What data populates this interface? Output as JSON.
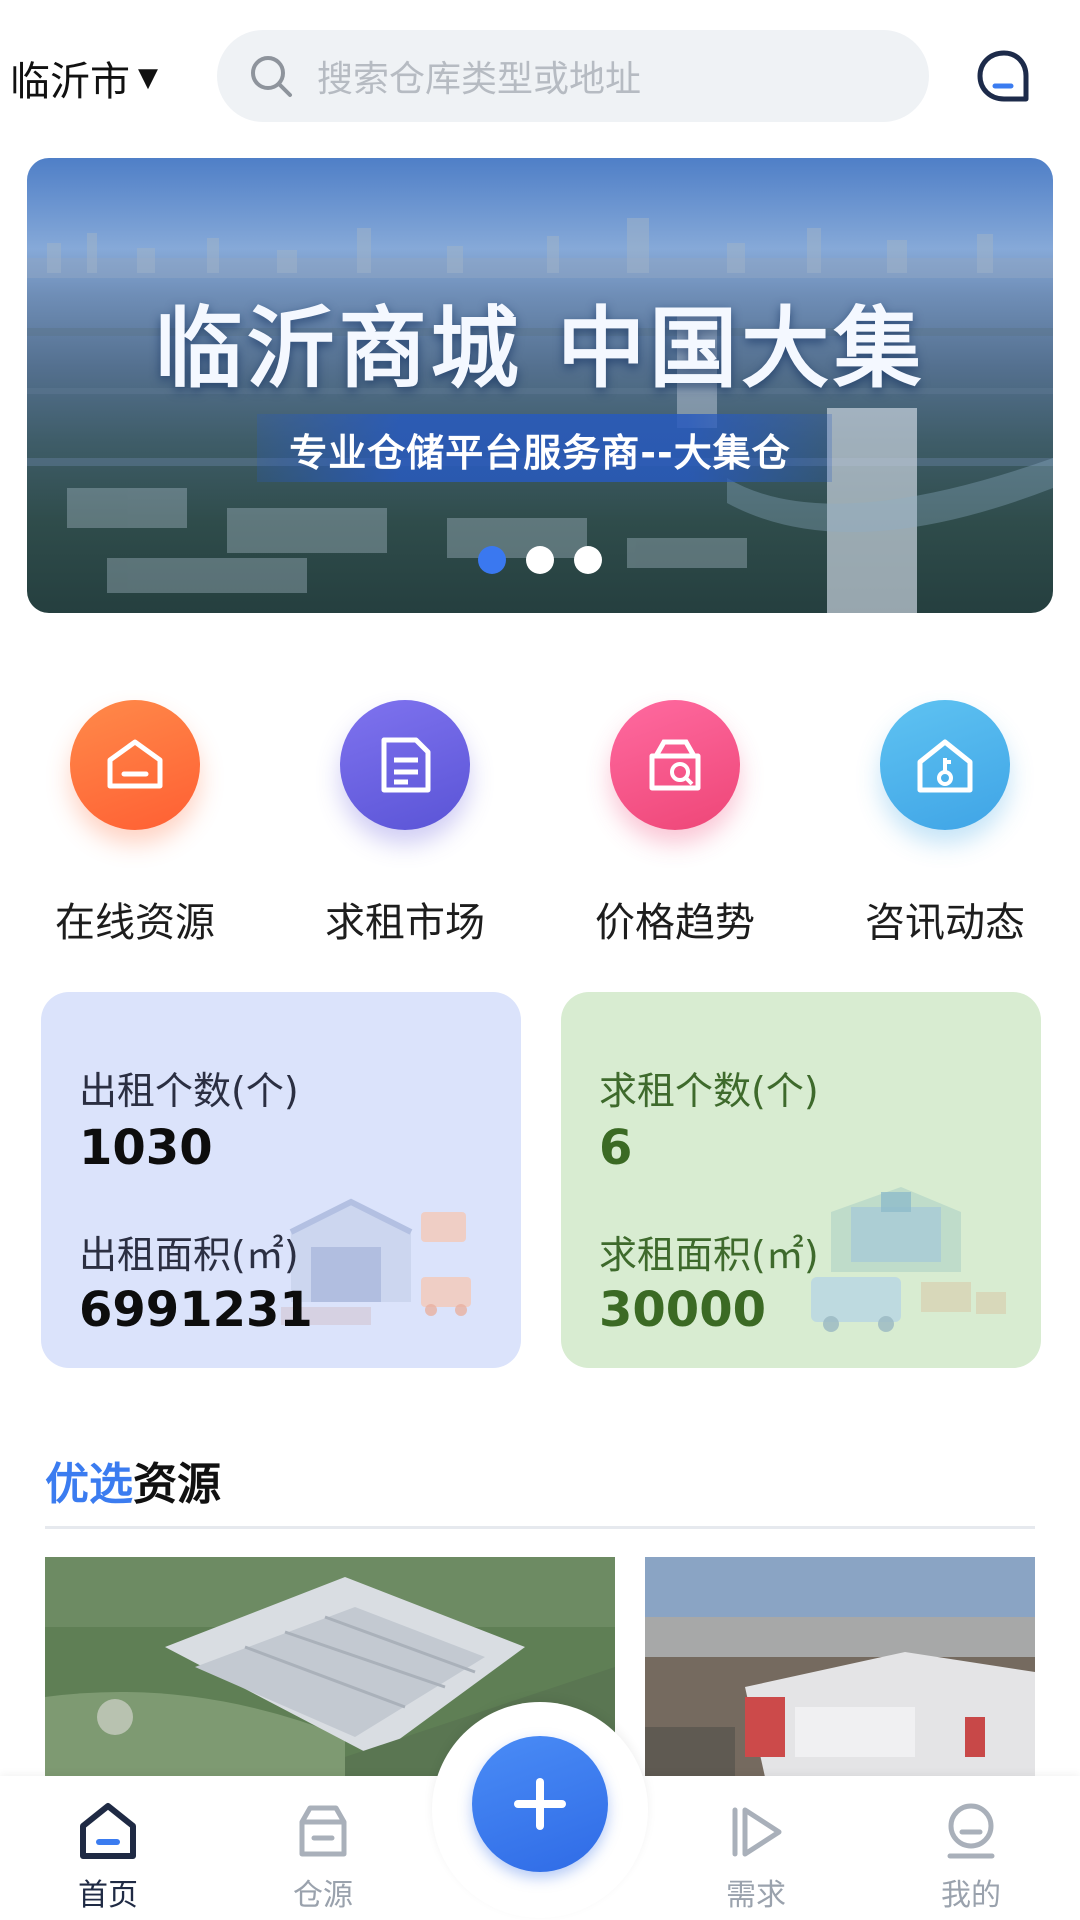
{
  "header": {
    "city": "临沂市",
    "search_placeholder": "搜索仓库类型或地址"
  },
  "banner": {
    "title": "临沂商城 中国大集",
    "subtitle": "专业仓储平台服务商--大集仓",
    "dots": 3,
    "active_dot": 1
  },
  "entries": [
    {
      "label": "在线资源",
      "icon": "warehouse-icon",
      "color": "#ff6f3a"
    },
    {
      "label": "求租市场",
      "icon": "document-list-icon",
      "color": "#6a62e0"
    },
    {
      "label": "价格趋势",
      "icon": "search-box-icon",
      "color": "#f2558a"
    },
    {
      "label": "咨讯动态",
      "icon": "house-key-icon",
      "color": "#4fb2ec"
    }
  ],
  "stats": {
    "rent_count_label": "出租个数(个)",
    "rent_count": "1030",
    "rent_area_label": "出租面积(㎡)",
    "rent_area": "6991231",
    "seek_count_label": "求租个数(个)",
    "seek_count": "6",
    "seek_area_label": "求租面积(㎡)",
    "seek_area": "30000"
  },
  "featured": {
    "title_accent": "优选",
    "title_rest": "资源"
  },
  "nav": {
    "home": "首页",
    "warehouse": "仓源",
    "demand": "需求",
    "mine": "我的"
  },
  "colors": {
    "accent": "#3b7cf0",
    "rent_card": "#dbe3fb",
    "seek_card": "#d8ecd1"
  }
}
